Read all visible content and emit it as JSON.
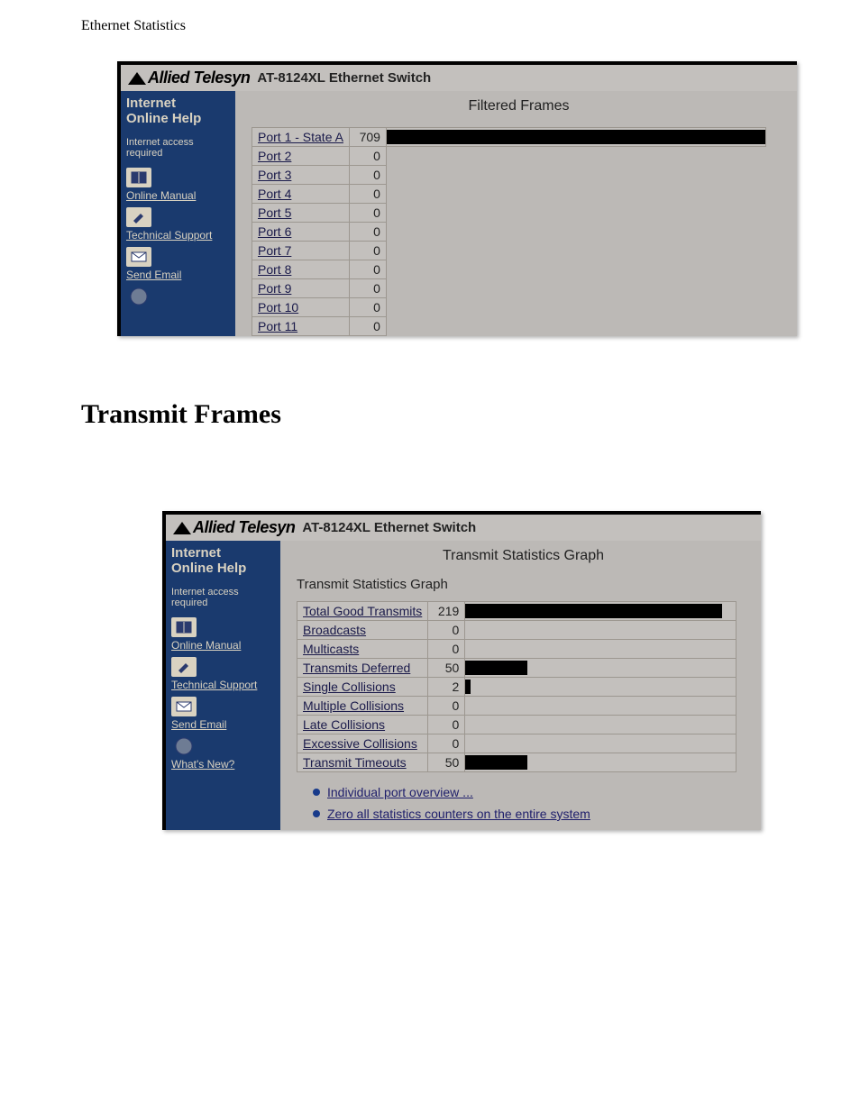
{
  "page_top_label": "Ethernet Statistics",
  "brand": "Allied Telesyn",
  "device": "AT-8124XL Ethernet Switch",
  "sidebar": {
    "heading_line1": "Internet",
    "heading_line2": "Online Help",
    "mini_line1": "Internet access",
    "mini_line2": "required",
    "items": [
      {
        "name": "online-manual",
        "label": "Online Manual"
      },
      {
        "name": "technical-support",
        "label": "Technical Support"
      },
      {
        "name": "send-email",
        "label": "Send Email"
      },
      {
        "name": "whats-new",
        "label": "What's New?"
      }
    ]
  },
  "filtered_panel": {
    "title": "Filtered Frames",
    "rows": [
      {
        "label": "Port 1 - State A",
        "value": 709
      },
      {
        "label": "Port 2",
        "value": 0
      },
      {
        "label": "Port 3",
        "value": 0
      },
      {
        "label": "Port 4",
        "value": 0
      },
      {
        "label": "Port 5",
        "value": 0
      },
      {
        "label": "Port 6",
        "value": 0
      },
      {
        "label": "Port 7",
        "value": 0
      },
      {
        "label": "Port 8",
        "value": 0
      },
      {
        "label": "Port 9",
        "value": 0
      },
      {
        "label": "Port 10",
        "value": 0
      },
      {
        "label": "Port 11",
        "value": 0
      }
    ]
  },
  "section_heading": "Transmit Frames",
  "transmit_panel": {
    "title": "Transmit Statistics Graph",
    "subtitle": "Transmit Statistics Graph",
    "rows": [
      {
        "label": "Total Good Transmits",
        "value": 219,
        "bar": "bar-219"
      },
      {
        "label": "Broadcasts",
        "value": 0,
        "bar": "bar-0"
      },
      {
        "label": "Multicasts",
        "value": 0,
        "bar": "bar-0"
      },
      {
        "label": "Transmits Deferred",
        "value": 50,
        "bar": "bar-50"
      },
      {
        "label": "Single Collisions",
        "value": 2,
        "bar": "bar-2"
      },
      {
        "label": "Multiple Collisions",
        "value": 0,
        "bar": "bar-0"
      },
      {
        "label": "Late Collisions",
        "value": 0,
        "bar": "bar-0"
      },
      {
        "label": "Excessive Collisions",
        "value": 0,
        "bar": "bar-0"
      },
      {
        "label": "Transmit Timeouts",
        "value": 50,
        "bar": "bar-50"
      }
    ],
    "bullets": [
      "Individual port overview ...",
      "Zero all statistics counters on the entire system"
    ]
  },
  "chart_data": [
    {
      "type": "bar",
      "title": "Filtered Frames",
      "categories": [
        "Port 1 - State A",
        "Port 2",
        "Port 3",
        "Port 4",
        "Port 5",
        "Port 6",
        "Port 7",
        "Port 8",
        "Port 9",
        "Port 10",
        "Port 11"
      ],
      "values": [
        709,
        0,
        0,
        0,
        0,
        0,
        0,
        0,
        0,
        0,
        0
      ],
      "xlabel": "",
      "ylabel": "",
      "ylim": [
        0,
        709
      ]
    },
    {
      "type": "bar",
      "title": "Transmit Statistics Graph",
      "categories": [
        "Total Good Transmits",
        "Broadcasts",
        "Multicasts",
        "Transmits Deferred",
        "Single Collisions",
        "Multiple Collisions",
        "Late Collisions",
        "Excessive Collisions",
        "Transmit Timeouts"
      ],
      "values": [
        219,
        0,
        0,
        50,
        2,
        0,
        0,
        0,
        50
      ],
      "xlabel": "",
      "ylabel": "",
      "ylim": [
        0,
        219
      ]
    }
  ]
}
